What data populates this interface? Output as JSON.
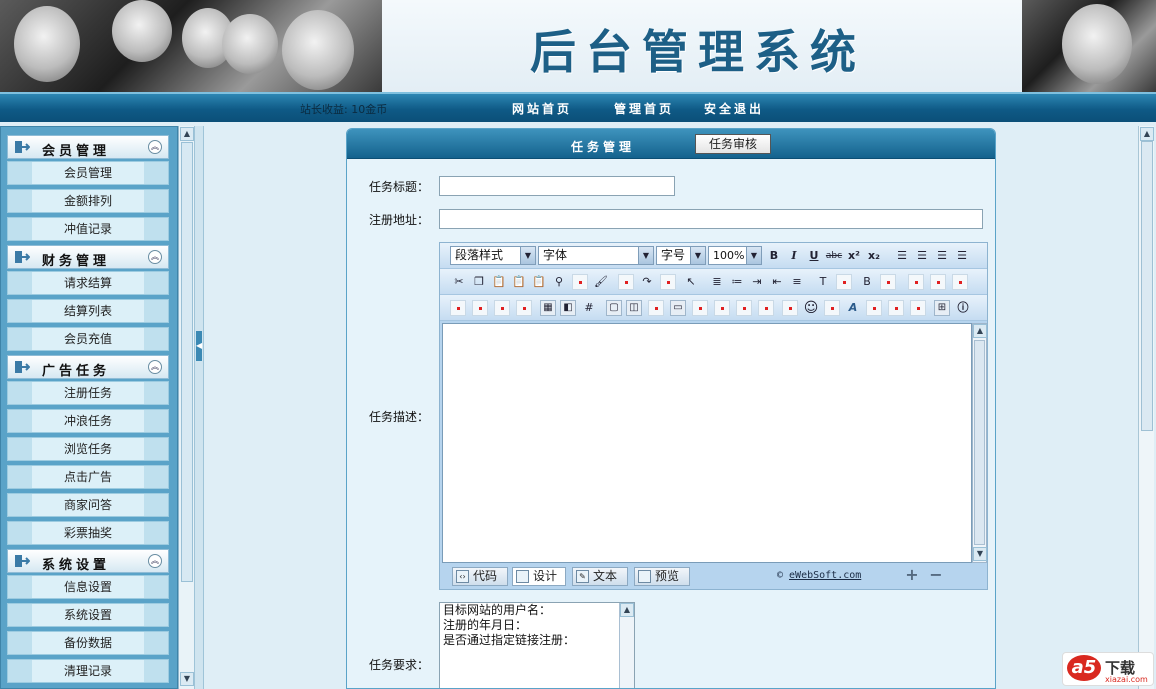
{
  "header": {
    "title": "后台管理系统"
  },
  "nav": {
    "earnings": "站长收益: 10金币",
    "links": [
      "网站首页",
      "管理首页",
      "安全退出"
    ]
  },
  "sidebar": {
    "groups": [
      {
        "label": "会员管理",
        "items": [
          "会员管理",
          "金额排列",
          "冲值记录"
        ]
      },
      {
        "label": "财务管理",
        "items": [
          "请求结算",
          "结算列表",
          "会员充值"
        ]
      },
      {
        "label": "广告任务",
        "items": [
          "注册任务",
          "冲浪任务",
          "浏览任务",
          "点击广告",
          "商家问答",
          "彩票抽奖"
        ]
      },
      {
        "label": "系统设置",
        "items": [
          "信息设置",
          "系统设置",
          "备份数据",
          "清理记录"
        ]
      }
    ]
  },
  "panel": {
    "title": "任务管理",
    "review_button": "任务审核",
    "fields": {
      "task_title_label": "任务标题：",
      "task_title_value": "",
      "reg_url_label": "注册地址：",
      "reg_url_value": "",
      "description_label": "任务描述：",
      "requirements_label": "任务要求："
    },
    "requirements_lines": [
      "目标网站的用户名：",
      "注册的年月日：",
      "是否通过指定链接注册："
    ]
  },
  "editor": {
    "paragraph_style": "段落样式",
    "font": "字体",
    "font_size": "字号",
    "zoom": "100%",
    "modes": [
      "代码",
      "设计",
      "文本",
      "预览"
    ],
    "active_mode": "设计",
    "copyright": "eWebSoft.com"
  },
  "watermark": {
    "logo": "a5",
    "text": "下载",
    "site": "xiazai.com"
  }
}
